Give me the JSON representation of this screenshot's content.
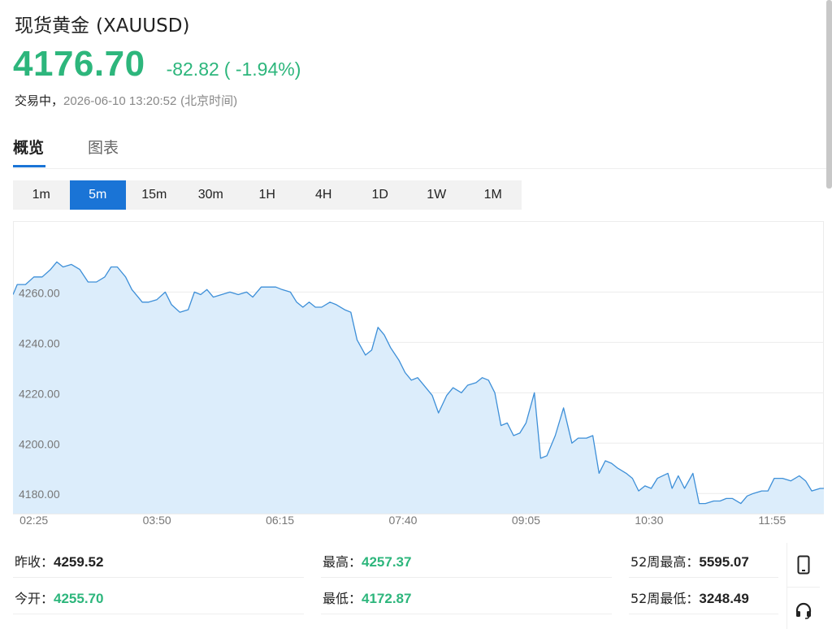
{
  "header": {
    "title": "现货黄金",
    "symbol": "(XAUUSD)",
    "price": "4176.70",
    "change": "-82.82",
    "change_pct": "( -1.94%)",
    "status": "交易中，",
    "timestamp": "2026-06-10 13:20:52",
    "timezone": "(北京时间)"
  },
  "tabs": [
    {
      "label": "概览",
      "active": true
    },
    {
      "label": "图表",
      "active": false
    }
  ],
  "periods": [
    {
      "label": "1m",
      "active": false
    },
    {
      "label": "5m",
      "active": true
    },
    {
      "label": "15m",
      "active": false
    },
    {
      "label": "30m",
      "active": false
    },
    {
      "label": "1H",
      "active": false
    },
    {
      "label": "4H",
      "active": false
    },
    {
      "label": "1D",
      "active": false
    },
    {
      "label": "1W",
      "active": false
    },
    {
      "label": "1M",
      "active": false
    }
  ],
  "stats": {
    "prev_close_label": "昨收：",
    "prev_close": "4259.52",
    "open_label": "今开：",
    "open": "4255.70",
    "high_label": "最高：",
    "high": "4257.37",
    "low_label": "最低：",
    "low": "4172.87",
    "w52_high_label": "52周最高：",
    "w52_high": "5595.07",
    "w52_low_label": "52周最低：",
    "w52_low": "3248.49"
  },
  "icons": [
    "mobile-phone-icon",
    "headset-icon"
  ],
  "colors": {
    "up_green": "#2db67c",
    "accent_blue": "#1a74d6",
    "line": "#3d8fd8",
    "area": "#dcedfb"
  },
  "chart_data": {
    "type": "area",
    "ylim": [
      4172,
      4285
    ],
    "yticks": [
      4180,
      4200,
      4220,
      4240,
      4260
    ],
    "ytick_labels": [
      "4180.00",
      "4200.00",
      "4220.00",
      "4240.00",
      "4260.00"
    ],
    "xticks": [
      2.78,
      19.17,
      35.56,
      51.94,
      68.33,
      84.72,
      101.11
    ],
    "xtick_labels": [
      "02:25",
      "03:50",
      "06:15",
      "07:40",
      "09:05",
      "10:30",
      "11:55"
    ],
    "xlim": [
      0,
      108
    ],
    "grid": true,
    "series": [
      {
        "values": [
          [
            0,
            4259
          ],
          [
            0.56,
            4263
          ],
          [
            1.67,
            4263
          ],
          [
            2.78,
            4266
          ],
          [
            3.89,
            4266
          ],
          [
            5,
            4269
          ],
          [
            5.83,
            4272
          ],
          [
            6.67,
            4270
          ],
          [
            7.78,
            4271
          ],
          [
            8.89,
            4269
          ],
          [
            10,
            4264
          ],
          [
            11.11,
            4264
          ],
          [
            12.22,
            4266
          ],
          [
            13.06,
            4270
          ],
          [
            13.89,
            4270
          ],
          [
            15,
            4266
          ],
          [
            15.83,
            4261
          ],
          [
            16.67,
            4258
          ],
          [
            17.22,
            4256
          ],
          [
            18.06,
            4256
          ],
          [
            19.17,
            4257
          ],
          [
            20.28,
            4260
          ],
          [
            21.11,
            4255
          ],
          [
            22.22,
            4252
          ],
          [
            23.33,
            4253
          ],
          [
            24.17,
            4260
          ],
          [
            25,
            4259
          ],
          [
            25.83,
            4261
          ],
          [
            26.67,
            4258
          ],
          [
            27.78,
            4259
          ],
          [
            28.89,
            4260
          ],
          [
            30,
            4259
          ],
          [
            31.11,
            4260
          ],
          [
            31.94,
            4258
          ],
          [
            33.06,
            4262
          ],
          [
            34.17,
            4262
          ],
          [
            35,
            4262
          ],
          [
            35.83,
            4261
          ],
          [
            36.94,
            4260
          ],
          [
            37.78,
            4256
          ],
          [
            38.61,
            4254
          ],
          [
            39.44,
            4256
          ],
          [
            40.28,
            4254
          ],
          [
            41.11,
            4254
          ],
          [
            42.22,
            4256
          ],
          [
            43.06,
            4255
          ],
          [
            44.17,
            4253
          ],
          [
            45,
            4252
          ],
          [
            45.83,
            4241
          ],
          [
            46.94,
            4235
          ],
          [
            47.78,
            4237
          ],
          [
            48.61,
            4246
          ],
          [
            49.44,
            4243
          ],
          [
            50.28,
            4238
          ],
          [
            51.39,
            4233
          ],
          [
            52.22,
            4228
          ],
          [
            53.06,
            4225
          ],
          [
            53.89,
            4226
          ],
          [
            55,
            4222
          ],
          [
            55.83,
            4219
          ],
          [
            56.67,
            4212
          ],
          [
            57.78,
            4219
          ],
          [
            58.61,
            4222
          ],
          [
            59.72,
            4220
          ],
          [
            60.56,
            4223
          ],
          [
            61.67,
            4224
          ],
          [
            62.5,
            4226
          ],
          [
            63.33,
            4225
          ],
          [
            64.17,
            4220
          ],
          [
            65,
            4207
          ],
          [
            65.83,
            4208
          ],
          [
            66.67,
            4203
          ],
          [
            67.5,
            4204
          ],
          [
            68.33,
            4208
          ],
          [
            69.44,
            4220
          ],
          [
            70.28,
            4194
          ],
          [
            71.11,
            4195
          ],
          [
            72.22,
            4203
          ],
          [
            73.33,
            4214
          ],
          [
            74.44,
            4200
          ],
          [
            75.28,
            4202
          ],
          [
            76.39,
            4202
          ],
          [
            77.22,
            4203
          ],
          [
            78.06,
            4188
          ],
          [
            78.89,
            4193
          ],
          [
            79.72,
            4192
          ],
          [
            80.56,
            4190
          ],
          [
            81.67,
            4188
          ],
          [
            82.5,
            4186
          ],
          [
            83.33,
            4181
          ],
          [
            84.17,
            4183
          ],
          [
            85,
            4182
          ],
          [
            85.83,
            4186
          ],
          [
            87.22,
            4188
          ],
          [
            87.78,
            4182
          ],
          [
            88.61,
            4187
          ],
          [
            89.44,
            4182
          ],
          [
            90.56,
            4188
          ],
          [
            91.39,
            4176
          ],
          [
            92.22,
            4176
          ],
          [
            93.33,
            4177
          ],
          [
            94.17,
            4177
          ],
          [
            95,
            4178
          ],
          [
            95.83,
            4178
          ],
          [
            96.94,
            4176
          ],
          [
            97.78,
            4179
          ],
          [
            98.61,
            4180
          ],
          [
            99.72,
            4181
          ],
          [
            100.56,
            4181
          ],
          [
            101.39,
            4186
          ],
          [
            102.5,
            4186
          ],
          [
            103.61,
            4185
          ],
          [
            104.72,
            4187
          ],
          [
            105.56,
            4185
          ],
          [
            106.39,
            4181
          ],
          [
            107.5,
            4182
          ],
          [
            108,
            4182
          ]
        ]
      }
    ]
  }
}
